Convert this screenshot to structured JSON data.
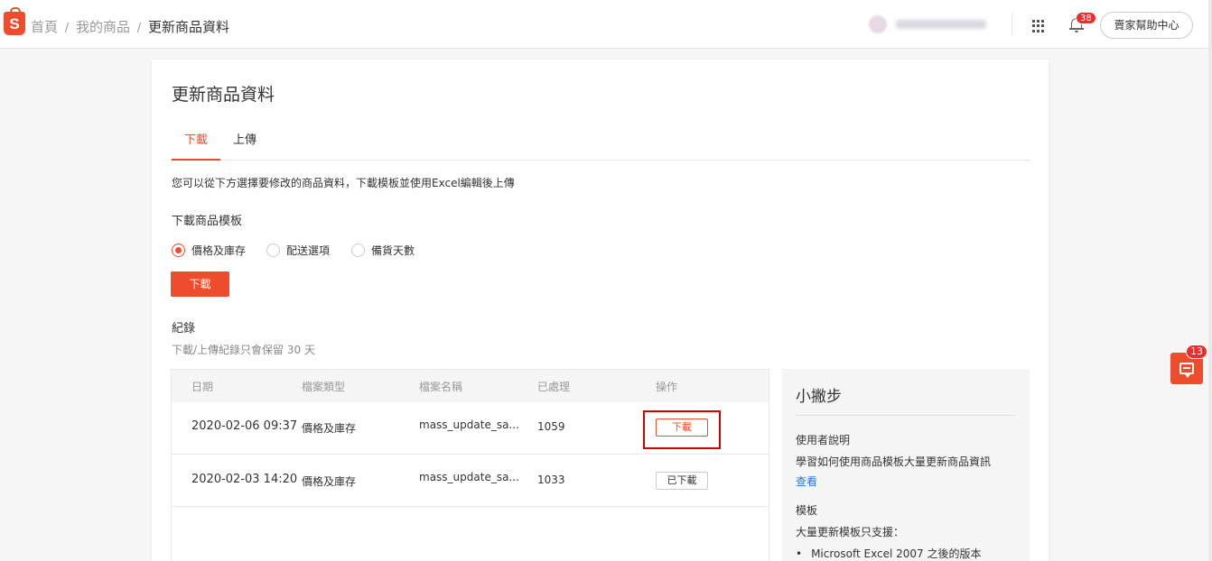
{
  "header": {
    "logo_letter": "S",
    "breadcrumb": [
      "首頁",
      "我的商品",
      "更新商品資料"
    ],
    "breadcrumb_sep": "/",
    "notification_count": "38",
    "help_label": "賣家幫助中心"
  },
  "page": {
    "title": "更新商品資料",
    "tabs": [
      {
        "label": "下載",
        "active": true
      },
      {
        "label": "上傳",
        "active": false
      }
    ],
    "description": "您可以從下方選擇要修改的商品資料，下載模板並使用Excel編輯後上傳",
    "template_section_label": "下載商品模板",
    "template_options": [
      {
        "label": "價格及庫存",
        "checked": true
      },
      {
        "label": "配送選項",
        "checked": false
      },
      {
        "label": "備貨天數",
        "checked": false
      }
    ],
    "download_button": "下載",
    "records_label": "紀錄",
    "records_subtitle": "下載/上傳紀錄只會保留 30 天"
  },
  "table": {
    "columns": [
      "日期",
      "檔案類型",
      "檔案名稱",
      "已處理",
      "操作"
    ],
    "rows": [
      {
        "date": "2020-02-06 09:37",
        "type": "價格及庫存",
        "filename": "mass_update_sa...",
        "processed": "1059",
        "action": "下載"
      },
      {
        "date": "2020-02-03 14:20",
        "type": "價格及庫存",
        "filename": "mass_update_sa...",
        "processed": "1033",
        "action": "已下載"
      }
    ]
  },
  "tips": {
    "title": "小撇步",
    "guide_heading": "使用者說明",
    "guide_text": "學習如何使用商品模板大量更新商品資訊",
    "guide_link": "查看",
    "template_heading": "模板",
    "template_text": "大量更新模板只支援：",
    "template_bullets": [
      "Microsoft Excel 2007 之後的版本"
    ]
  },
  "chat": {
    "badge": "13"
  },
  "colors": {
    "accent": "#ee4d2d",
    "highlight": "#d40000",
    "link": "#2673dd"
  }
}
